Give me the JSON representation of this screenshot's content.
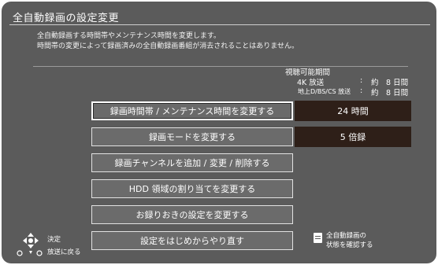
{
  "screen": {
    "title": "全自動録画の設定変更",
    "description": [
      "全自動録画する時間帯やメンテナンス時間を変更します。",
      "時間帯の変更によって録画済みの全自動録画番組が消去されることはありません。"
    ]
  },
  "viewing_period": {
    "heading": "視聴可能期間",
    "row_4k": {
      "label": "4K 放送",
      "sep": ":",
      "value": "約　8 日間"
    },
    "row_bs": {
      "label": "地上D/BS/CS 放送",
      "sep": ":",
      "value": "約　8 日間"
    }
  },
  "menu": [
    {
      "label": "録画時間帯 / メンテナンス時間を変更する",
      "selected": true,
      "value": "24 時間"
    },
    {
      "label": "録画モードを変更する",
      "selected": false,
      "value": "5 倍録"
    },
    {
      "label": "録画チャンネルを追加 / 変更 / 削除する",
      "selected": false
    },
    {
      "label": "HDD 領域の割り当てを変更する",
      "selected": false
    },
    {
      "label": "お録りおきの設定を変更する",
      "selected": false
    },
    {
      "label": "設定をはじめからやり直す",
      "selected": false
    }
  ],
  "footer": {
    "decide_label": "決定",
    "back_label": "放送に戻る",
    "status_label_line1": "全自動録画の",
    "status_label_line2": "状態を確認する"
  },
  "colors": {
    "background": "#5b5b5b",
    "value_box": "#2e1f18",
    "button": "#6b6b6b"
  }
}
